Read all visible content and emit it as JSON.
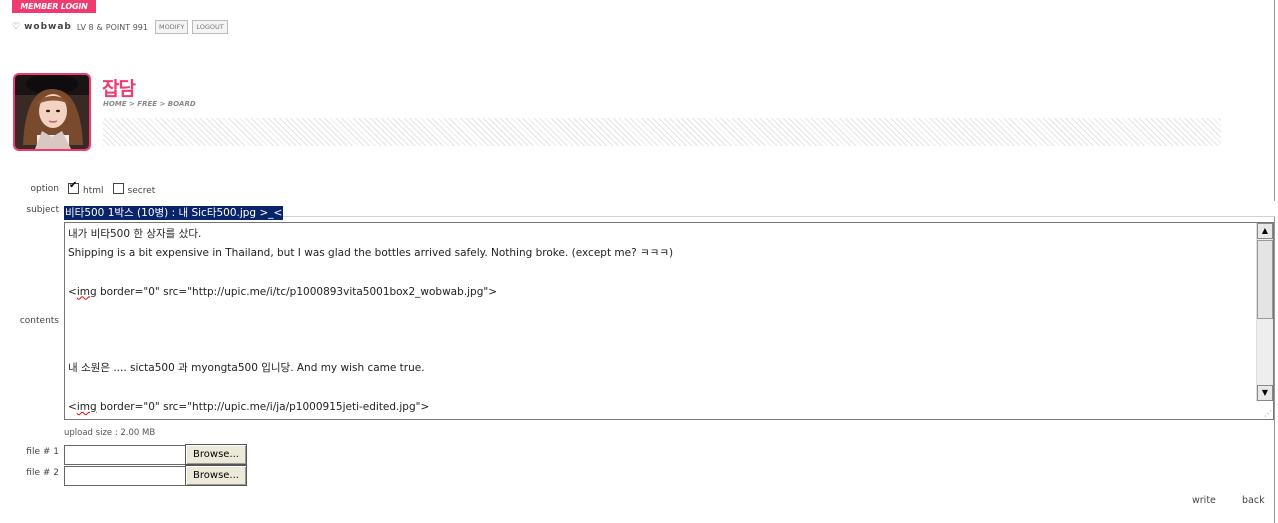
{
  "member": {
    "login_label": "MEMBER LOGIN",
    "username": "wobwab",
    "level": "LV 8",
    "amp": "&",
    "point": "POINT 991",
    "modify_label": "MODIFY",
    "logout_label": "LOGOUT"
  },
  "header": {
    "title": "잡담",
    "breadcrumb": "HOME > FREE > BOARD"
  },
  "form": {
    "option_label": "option",
    "html_label": "html",
    "html_checked": true,
    "secret_label": "secret",
    "secret_checked": false,
    "subject_label": "subject",
    "subject_value": "비타500 1박스 (10병) : 내 Sic타500.jpg >_<",
    "contents_label": "contents",
    "contents": {
      "line1": "내가 비타500 한 상자를 샀다.",
      "line2": "Shipping is a bit expensive in Thailand, but I was glad the bottles arrived safely. Nothing broke. (except me? ㅋㅋㅋ)",
      "line4_a": "<",
      "line4_img": "img",
      "line4_b": " border=\"0\" src=\"http://upic.me/i/tc/p1000893vita5001box2_wobwab.jpg\">",
      "line8": "내 소원은 .... sicta500 과 myongta500 입니당. And my wish came true.",
      "line10_a": "<",
      "line10_img": "img",
      "line10_b": " border=\"0\" src=\"http://upic.me/i/ja/p1000915jeti-edited.jpg\">"
    },
    "upload_size": "upload size : 2.00 MB",
    "file1_label": "file # 1",
    "file2_label": "file # 2",
    "browse_label": "Browse...",
    "write_label": "write",
    "back_label": "back"
  },
  "colors": {
    "accent": "#ef3b6f",
    "selection": "#0a246a"
  }
}
